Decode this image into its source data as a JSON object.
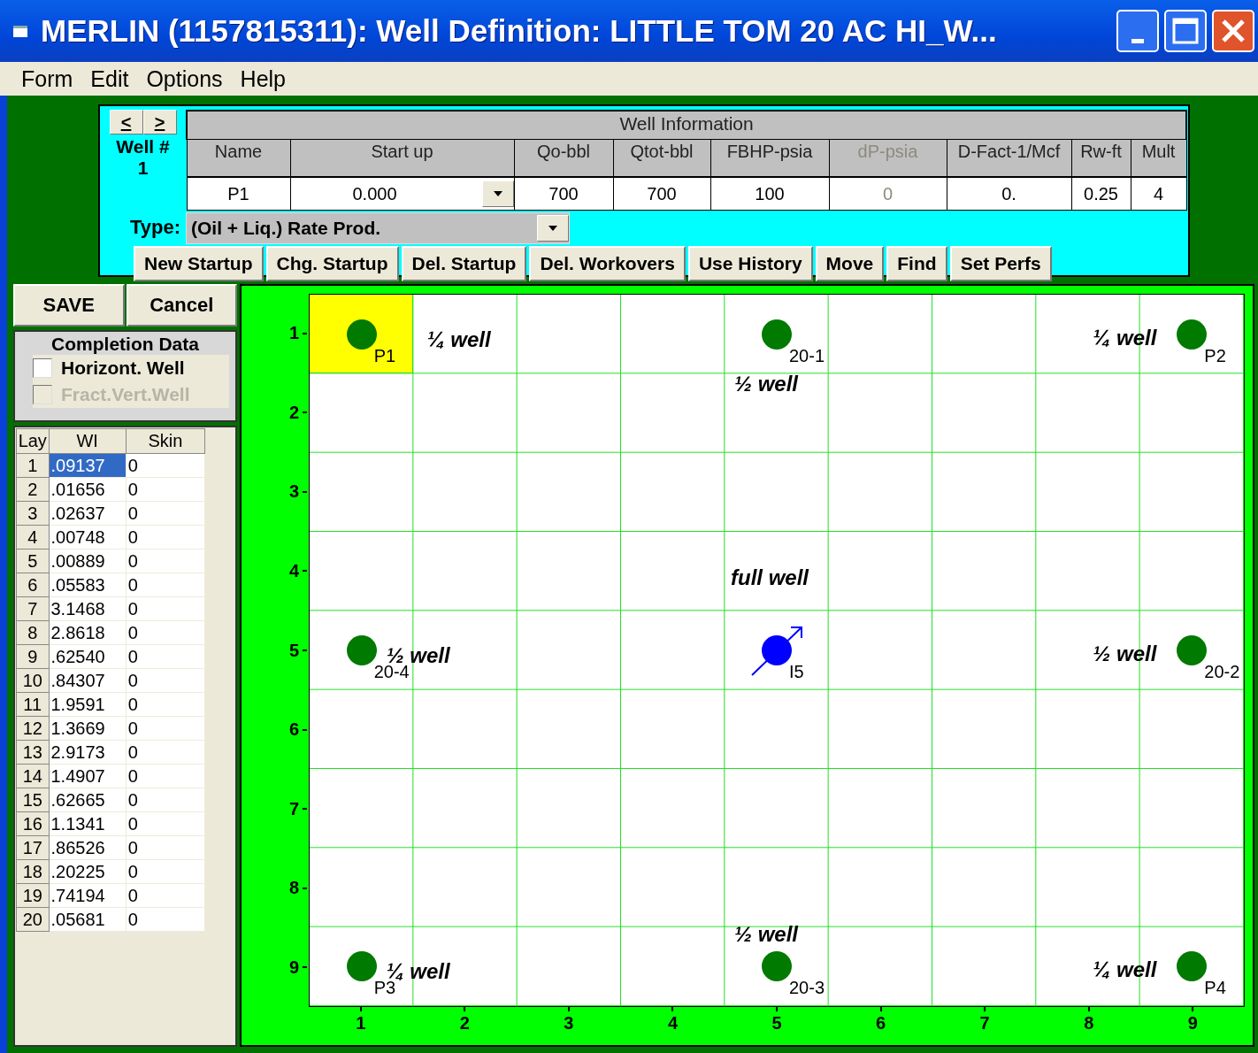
{
  "window": {
    "title": "MERLIN (1157815311): Well Definition:  LITTLE TOM 20 AC HI_W..."
  },
  "menu": [
    {
      "label": "Form"
    },
    {
      "label": "Edit"
    },
    {
      "label": "Options"
    },
    {
      "label": "Help"
    }
  ],
  "well_nav": {
    "prev": "<",
    "next": ">",
    "label": "Well #",
    "number": "1"
  },
  "well_info": {
    "title": "Well Information",
    "columns": [
      {
        "label": "Name",
        "value": "P1",
        "disabled": false,
        "kind": "text"
      },
      {
        "label": "Start up",
        "value": "0.000",
        "disabled": false,
        "kind": "dropdown"
      },
      {
        "label": "Qo-bbl",
        "value": "700",
        "disabled": false,
        "kind": "text"
      },
      {
        "label": "Qtot-bbl",
        "value": "700",
        "disabled": false,
        "kind": "text"
      },
      {
        "label": "FBHP-psia",
        "value": "100",
        "disabled": false,
        "kind": "text"
      },
      {
        "label": "dP-psia",
        "value": "0",
        "disabled": true,
        "kind": "text"
      },
      {
        "label": "D-Fact-1/Mcf",
        "value": "0.",
        "disabled": false,
        "kind": "text"
      },
      {
        "label": "Rw-ft",
        "value": "0.25",
        "disabled": false,
        "kind": "text"
      },
      {
        "label": "Mult",
        "value": "4",
        "disabled": false,
        "kind": "text"
      }
    ]
  },
  "type": {
    "label": "Type:",
    "value": "(Oil + Liq.) Rate Prod."
  },
  "actions": [
    {
      "label": "New Startup"
    },
    {
      "label": "Chg. Startup"
    },
    {
      "label": "Del. Startup"
    },
    {
      "label": "Del. Workovers"
    },
    {
      "label": "Use History"
    },
    {
      "label": "Move"
    },
    {
      "label": "Find"
    },
    {
      "label": "Set Perfs"
    }
  ],
  "save_buttons": [
    {
      "label": "SAVE"
    },
    {
      "label": "Cancel"
    }
  ],
  "completion": {
    "title": "Completion Data",
    "options": [
      {
        "label": "Horizont. Well",
        "checked": false,
        "disabled": false
      },
      {
        "label": "Fract.Vert.Well",
        "checked": false,
        "disabled": true
      }
    ]
  },
  "layers": {
    "columns": [
      "Lay",
      "WI",
      "Skin"
    ],
    "rows": [
      {
        "lay": "1",
        "wi": ".09137",
        "skin": "0",
        "selected": true
      },
      {
        "lay": "2",
        "wi": ".01656",
        "skin": "0",
        "selected": false
      },
      {
        "lay": "3",
        "wi": ".02637",
        "skin": "0",
        "selected": false
      },
      {
        "lay": "4",
        "wi": ".00748",
        "skin": "0",
        "selected": false
      },
      {
        "lay": "5",
        "wi": ".00889",
        "skin": "0",
        "selected": false
      },
      {
        "lay": "6",
        "wi": ".05583",
        "skin": "0",
        "selected": false
      },
      {
        "lay": "7",
        "wi": "3.1468",
        "skin": "0",
        "selected": false
      },
      {
        "lay": "8",
        "wi": "2.8618",
        "skin": "0",
        "selected": false
      },
      {
        "lay": "9",
        "wi": ".62540",
        "skin": "0",
        "selected": false
      },
      {
        "lay": "10",
        "wi": ".84307",
        "skin": "0",
        "selected": false
      },
      {
        "lay": "11",
        "wi": "1.9591",
        "skin": "0",
        "selected": false
      },
      {
        "lay": "12",
        "wi": "1.3669",
        "skin": "0",
        "selected": false
      },
      {
        "lay": "13",
        "wi": "2.9173",
        "skin": "0",
        "selected": false
      },
      {
        "lay": "14",
        "wi": "1.4907",
        "skin": "0",
        "selected": false
      },
      {
        "lay": "15",
        "wi": ".62665",
        "skin": "0",
        "selected": false
      },
      {
        "lay": "16",
        "wi": "1.1341",
        "skin": "0",
        "selected": false
      },
      {
        "lay": "17",
        "wi": ".86526",
        "skin": "0",
        "selected": false
      },
      {
        "lay": "18",
        "wi": ".20225",
        "skin": "0",
        "selected": false
      },
      {
        "lay": "19",
        "wi": ".74194",
        "skin": "0",
        "selected": false
      },
      {
        "lay": "20",
        "wi": ".05681",
        "skin": "0",
        "selected": false
      }
    ]
  },
  "map": {
    "x_labels": [
      "1",
      "2",
      "3",
      "4",
      "5",
      "6",
      "7",
      "8",
      "9"
    ],
    "y_labels": [
      "1",
      "2",
      "3",
      "4",
      "5",
      "6",
      "7",
      "8",
      "9"
    ],
    "wells": [
      {
        "name": "P1",
        "kind": "producer",
        "selected": true,
        "share": "¼ well"
      },
      {
        "name": "20-1",
        "kind": "producer",
        "selected": false,
        "share": "½ well"
      },
      {
        "name": "P2",
        "kind": "producer",
        "selected": false,
        "share": "¼ well"
      },
      {
        "name": "20-4",
        "kind": "producer",
        "selected": false,
        "share": "½ well"
      },
      {
        "name": "I5",
        "kind": "injector",
        "selected": false,
        "share": "full well"
      },
      {
        "name": "20-2",
        "kind": "producer",
        "selected": false,
        "share": "½ well"
      },
      {
        "name": "P3",
        "kind": "producer",
        "selected": false,
        "share": "¼ well"
      },
      {
        "name": "20-3",
        "kind": "producer",
        "selected": false,
        "share": "½ well"
      },
      {
        "name": "P4",
        "kind": "producer",
        "selected": false,
        "share": "¼ well"
      }
    ]
  }
}
